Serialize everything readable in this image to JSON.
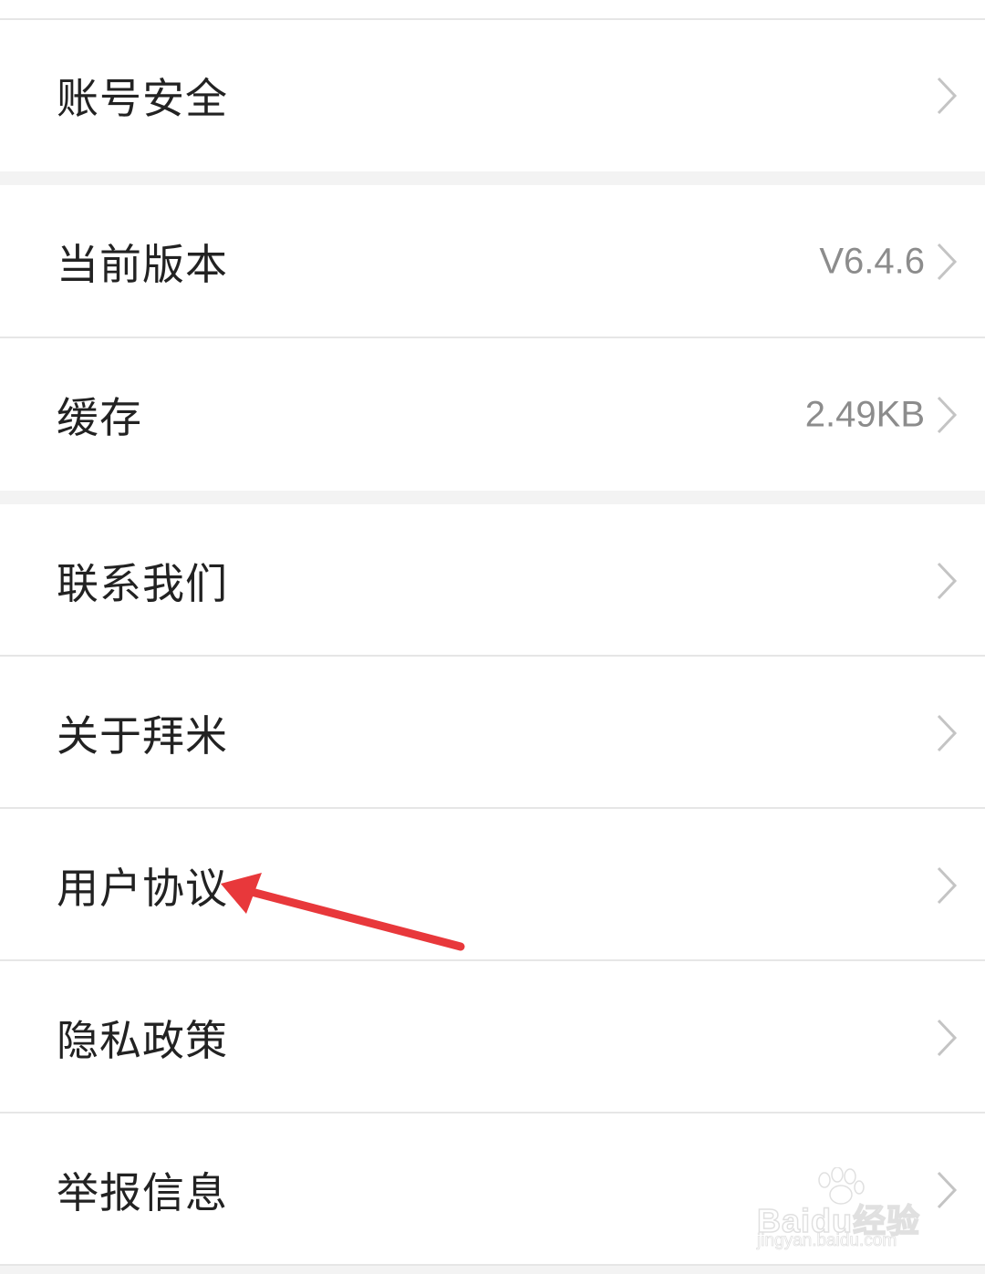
{
  "settings": {
    "rows": [
      {
        "label": "账号安全",
        "value": ""
      },
      {
        "label": "当前版本",
        "value": "V6.4.6"
      },
      {
        "label": "缓存",
        "value": "2.49KB"
      },
      {
        "label": "联系我们",
        "value": ""
      },
      {
        "label": "关于拜米",
        "value": ""
      },
      {
        "label": "用户协议",
        "value": ""
      },
      {
        "label": "隐私政策",
        "value": ""
      },
      {
        "label": "举报信息",
        "value": ""
      }
    ]
  },
  "annotation": {
    "arrow_color": "#e8383b",
    "points_to": "用户协议"
  },
  "watermark": {
    "brand_text": "Baidu经验",
    "url_text": "jingyan.baidu.com"
  },
  "colors": {
    "label": "#222222",
    "value": "#8c8c8c",
    "chevron": "#c4c4c4",
    "divider": "#e6e6e6",
    "section_gap": "#f3f3f3",
    "background": "#ffffff"
  }
}
